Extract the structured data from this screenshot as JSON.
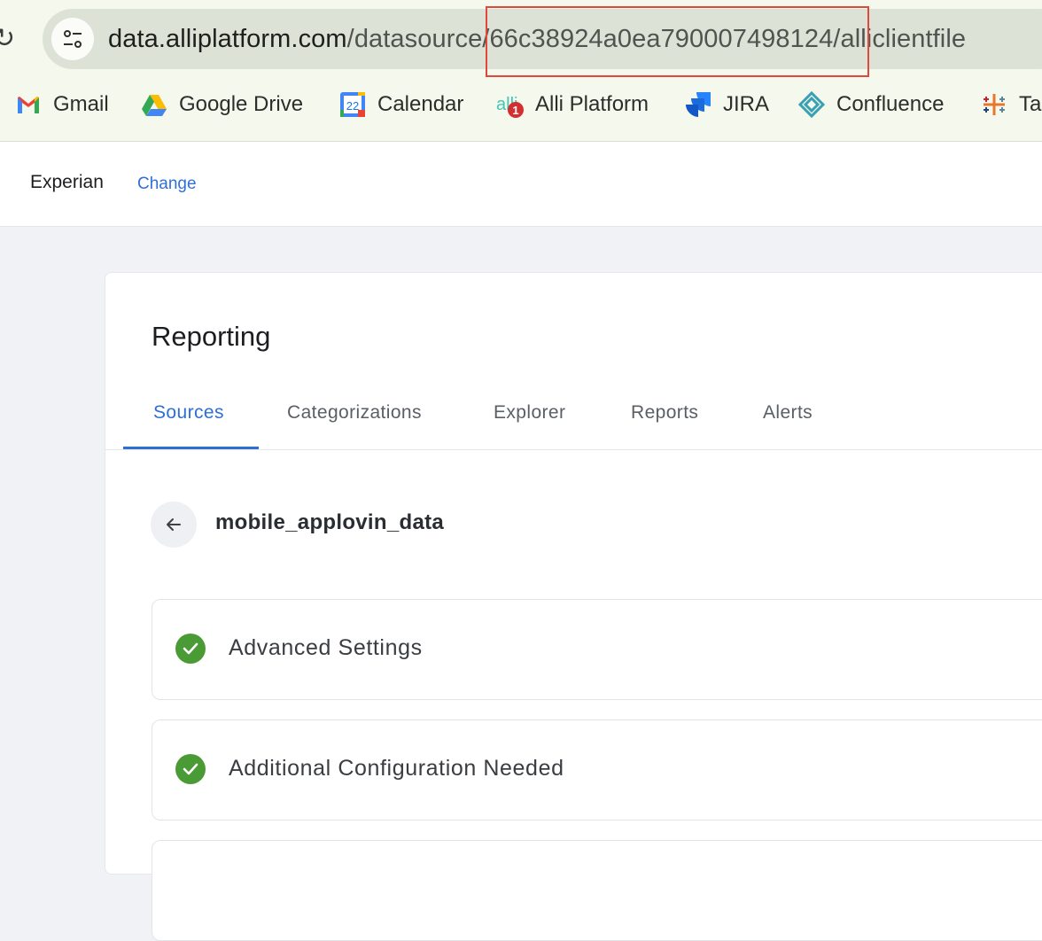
{
  "browser": {
    "url_host": "data.alliplatform.com",
    "url_path": "/datasource/66c38924a0ea790007498124/alliclientfile",
    "bookmarks": [
      {
        "label": "Gmail",
        "icon": "gmail-icon"
      },
      {
        "label": "Google Drive",
        "icon": "google-drive-icon"
      },
      {
        "label": "Calendar",
        "icon": "calendar-icon",
        "icon_text": "22"
      },
      {
        "label": "Alli Platform",
        "icon": "alli-icon",
        "badge": "1"
      },
      {
        "label": "JIRA",
        "icon": "jira-icon"
      },
      {
        "label": "Confluence",
        "icon": "confluence-icon"
      },
      {
        "label": "Ta",
        "icon": "tableau-icon"
      }
    ],
    "colors": {
      "highlight": "#e0483a"
    }
  },
  "header": {
    "client_name": "Experian",
    "change_label": "Change"
  },
  "main": {
    "title": "Reporting",
    "tabs": [
      {
        "label": "Sources",
        "active": true
      },
      {
        "label": "Categorizations",
        "active": false
      },
      {
        "label": "Explorer",
        "active": false
      },
      {
        "label": "Reports",
        "active": false
      },
      {
        "label": "Alerts",
        "active": false
      }
    ],
    "source_name": "mobile_applovin_data",
    "sections": [
      {
        "label": "Advanced Settings",
        "status": "complete"
      },
      {
        "label": "Additional Configuration Needed",
        "status": "complete"
      }
    ],
    "colors": {
      "accent": "#2e6fd4",
      "success": "#4a9b35"
    }
  }
}
